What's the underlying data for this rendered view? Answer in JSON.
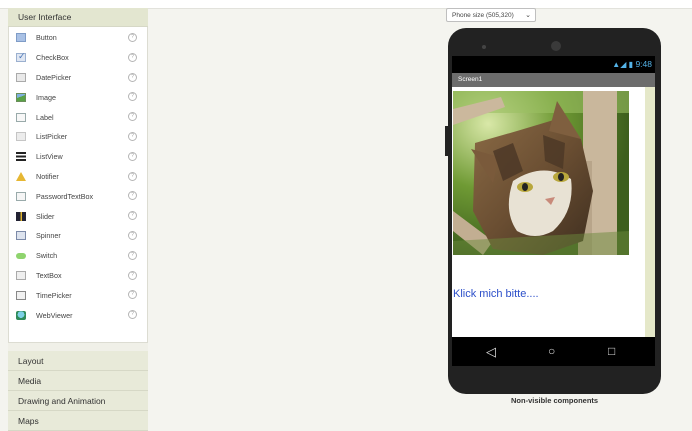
{
  "palette": {
    "open_category": "User Interface",
    "items": [
      {
        "label": "Button",
        "icon": "button-icon"
      },
      {
        "label": "CheckBox",
        "icon": "checkbox-icon"
      },
      {
        "label": "DatePicker",
        "icon": "datepicker-icon"
      },
      {
        "label": "Image",
        "icon": "image-icon"
      },
      {
        "label": "Label",
        "icon": "label-icon"
      },
      {
        "label": "ListPicker",
        "icon": "listpicker-icon"
      },
      {
        "label": "ListView",
        "icon": "listview-icon"
      },
      {
        "label": "Notifier",
        "icon": "notifier-icon"
      },
      {
        "label": "PasswordTextBox",
        "icon": "passwordtextbox-icon"
      },
      {
        "label": "Slider",
        "icon": "slider-icon"
      },
      {
        "label": "Spinner",
        "icon": "spinner-icon"
      },
      {
        "label": "Switch",
        "icon": "switch-icon"
      },
      {
        "label": "TextBox",
        "icon": "textbox-icon"
      },
      {
        "label": "TimePicker",
        "icon": "timepicker-icon"
      },
      {
        "label": "WebViewer",
        "icon": "webviewer-icon"
      }
    ],
    "help_glyph": "?",
    "collapsed_categories": [
      "Layout",
      "Media",
      "Drawing and Animation",
      "Maps"
    ]
  },
  "viewer": {
    "phone_size": "Phone size (505,320)",
    "status_time": "9:48",
    "screen_title": "Screen1",
    "label_text": "Klick mich bitte....",
    "non_visible": "Non-visible components"
  }
}
